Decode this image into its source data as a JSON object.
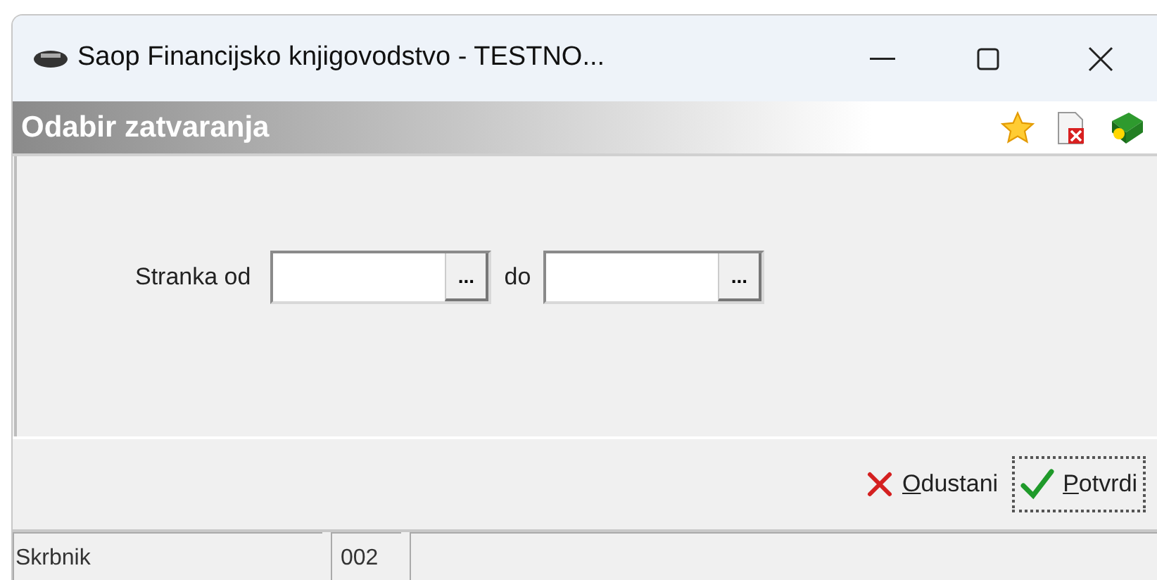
{
  "window": {
    "title": "Saop Financijsko knjigovodstvo - TESTNO..."
  },
  "header": {
    "title": "Odabir zatvaranja"
  },
  "form": {
    "label": "Stranka od",
    "separator": "do",
    "browse_from": "...",
    "browse_to": "..."
  },
  "buttons": [
    {
      "kind": "cancel",
      "label": "Odustani",
      "access_key_underlined": true,
      "focused": false
    },
    {
      "kind": "confirm",
      "label": "Potvrdi",
      "access_key_underlined": true,
      "focused": true
    }
  ],
  "status_bar": {
    "user": "Skrbnik",
    "code": "002"
  }
}
